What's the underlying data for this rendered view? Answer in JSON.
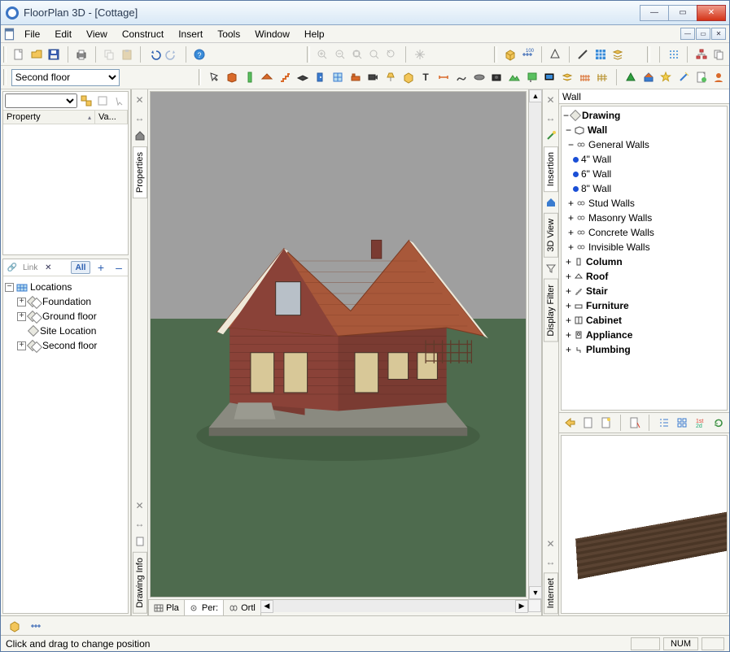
{
  "title": "FloorPlan 3D - [Cottage]",
  "menu": [
    "File",
    "Edit",
    "View",
    "Construct",
    "Insert",
    "Tools",
    "Window",
    "Help"
  ],
  "floor_selector": {
    "value": "Second floor"
  },
  "left_props": {
    "col_property": "Property",
    "col_value": "Va..."
  },
  "left_lower": {
    "link_label": "Link",
    "all_label": "All",
    "plus": "+",
    "minus": "–"
  },
  "locations_tree": {
    "root": "Locations",
    "children": [
      {
        "label": "Foundation",
        "expand": "+"
      },
      {
        "label": "Ground floor",
        "expand": "+"
      },
      {
        "label": "Site Location",
        "expand": null
      },
      {
        "label": "Second floor",
        "expand": "+"
      }
    ]
  },
  "vstrip_left": [
    {
      "label": "Properties",
      "active": true
    },
    {
      "label": "Drawing Info",
      "active": false
    }
  ],
  "viewtabs": [
    {
      "label": "Pla",
      "active": false
    },
    {
      "label": "Per:",
      "active": true
    },
    {
      "label": "Ortl",
      "active": false
    }
  ],
  "vstrip_right": [
    {
      "label": "Insertion",
      "active": true
    },
    {
      "label": "3D View",
      "active": false
    },
    {
      "label": "Display Filter",
      "active": false
    },
    {
      "label": "Internet",
      "active": false
    }
  ],
  "library_header": "Wall",
  "library_tree": {
    "root": "Drawing",
    "wall": "Wall",
    "general": "General Walls",
    "sizes": [
      "4\" Wall",
      "6\" Wall",
      "8\" Wall"
    ],
    "groups": [
      "Stud Walls",
      "Masonry Walls",
      "Concrete Walls",
      "Invisible Walls"
    ],
    "cats": [
      "Column",
      "Roof",
      "Stair",
      "Furniture",
      "Cabinet",
      "Appliance",
      "Plumbing"
    ]
  },
  "status": {
    "text": "Click and drag to change position",
    "num": "NUM"
  },
  "icons": {
    "new": "new",
    "open": "open",
    "save": "save",
    "print": "print",
    "copy": "copy",
    "paste": "paste",
    "undo": "undo",
    "redo": "redo",
    "help": "help"
  }
}
